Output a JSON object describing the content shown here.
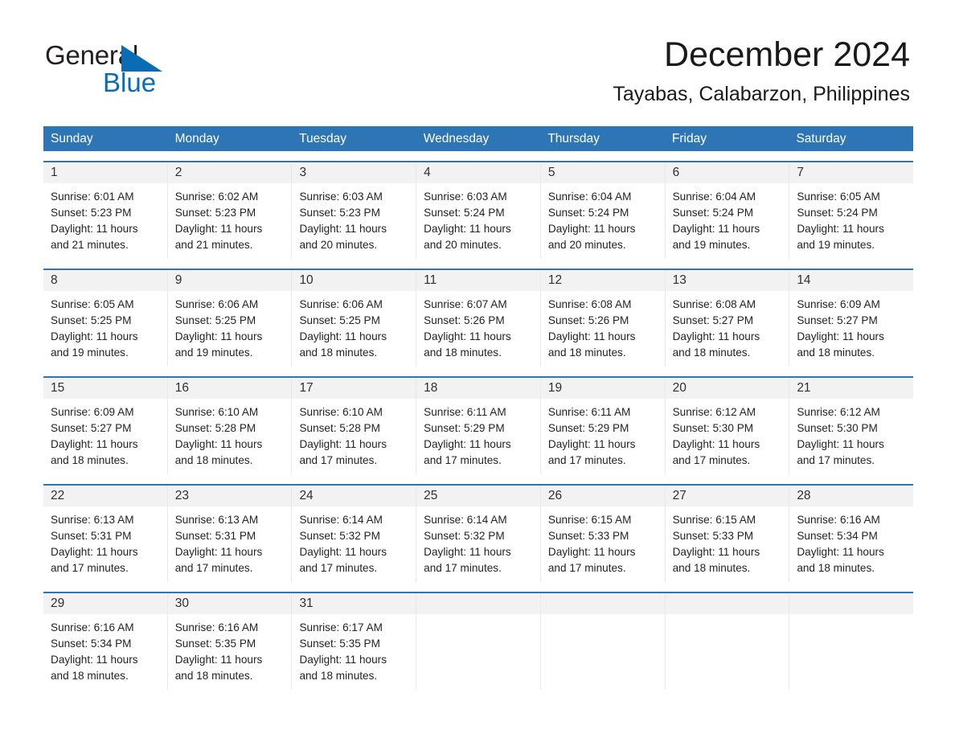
{
  "brand": {
    "name_part1": "General",
    "name_part2": "Blue",
    "triangle_color": "#0a6cb5"
  },
  "header": {
    "title": "December 2024",
    "subtitle": "Tayabas, Calabarzon, Philippines"
  },
  "theme": {
    "header_blue": "#2e75b6",
    "daynum_band": "#f2f2f2",
    "text": "#232323"
  },
  "calendar": {
    "weekday_headers": [
      "Sunday",
      "Monday",
      "Tuesday",
      "Wednesday",
      "Thursday",
      "Friday",
      "Saturday"
    ],
    "weeks": [
      [
        {
          "day": "1",
          "sunrise": "Sunrise: 6:01 AM",
          "sunset": "Sunset: 5:23 PM",
          "daylight_line1": "Daylight: 11 hours",
          "daylight_line2": "and 21 minutes."
        },
        {
          "day": "2",
          "sunrise": "Sunrise: 6:02 AM",
          "sunset": "Sunset: 5:23 PM",
          "daylight_line1": "Daylight: 11 hours",
          "daylight_line2": "and 21 minutes."
        },
        {
          "day": "3",
          "sunrise": "Sunrise: 6:03 AM",
          "sunset": "Sunset: 5:23 PM",
          "daylight_line1": "Daylight: 11 hours",
          "daylight_line2": "and 20 minutes."
        },
        {
          "day": "4",
          "sunrise": "Sunrise: 6:03 AM",
          "sunset": "Sunset: 5:24 PM",
          "daylight_line1": "Daylight: 11 hours",
          "daylight_line2": "and 20 minutes."
        },
        {
          "day": "5",
          "sunrise": "Sunrise: 6:04 AM",
          "sunset": "Sunset: 5:24 PM",
          "daylight_line1": "Daylight: 11 hours",
          "daylight_line2": "and 20 minutes."
        },
        {
          "day": "6",
          "sunrise": "Sunrise: 6:04 AM",
          "sunset": "Sunset: 5:24 PM",
          "daylight_line1": "Daylight: 11 hours",
          "daylight_line2": "and 19 minutes."
        },
        {
          "day": "7",
          "sunrise": "Sunrise: 6:05 AM",
          "sunset": "Sunset: 5:24 PM",
          "daylight_line1": "Daylight: 11 hours",
          "daylight_line2": "and 19 minutes."
        }
      ],
      [
        {
          "day": "8",
          "sunrise": "Sunrise: 6:05 AM",
          "sunset": "Sunset: 5:25 PM",
          "daylight_line1": "Daylight: 11 hours",
          "daylight_line2": "and 19 minutes."
        },
        {
          "day": "9",
          "sunrise": "Sunrise: 6:06 AM",
          "sunset": "Sunset: 5:25 PM",
          "daylight_line1": "Daylight: 11 hours",
          "daylight_line2": "and 19 minutes."
        },
        {
          "day": "10",
          "sunrise": "Sunrise: 6:06 AM",
          "sunset": "Sunset: 5:25 PM",
          "daylight_line1": "Daylight: 11 hours",
          "daylight_line2": "and 18 minutes."
        },
        {
          "day": "11",
          "sunrise": "Sunrise: 6:07 AM",
          "sunset": "Sunset: 5:26 PM",
          "daylight_line1": "Daylight: 11 hours",
          "daylight_line2": "and 18 minutes."
        },
        {
          "day": "12",
          "sunrise": "Sunrise: 6:08 AM",
          "sunset": "Sunset: 5:26 PM",
          "daylight_line1": "Daylight: 11 hours",
          "daylight_line2": "and 18 minutes."
        },
        {
          "day": "13",
          "sunrise": "Sunrise: 6:08 AM",
          "sunset": "Sunset: 5:27 PM",
          "daylight_line1": "Daylight: 11 hours",
          "daylight_line2": "and 18 minutes."
        },
        {
          "day": "14",
          "sunrise": "Sunrise: 6:09 AM",
          "sunset": "Sunset: 5:27 PM",
          "daylight_line1": "Daylight: 11 hours",
          "daylight_line2": "and 18 minutes."
        }
      ],
      [
        {
          "day": "15",
          "sunrise": "Sunrise: 6:09 AM",
          "sunset": "Sunset: 5:27 PM",
          "daylight_line1": "Daylight: 11 hours",
          "daylight_line2": "and 18 minutes."
        },
        {
          "day": "16",
          "sunrise": "Sunrise: 6:10 AM",
          "sunset": "Sunset: 5:28 PM",
          "daylight_line1": "Daylight: 11 hours",
          "daylight_line2": "and 18 minutes."
        },
        {
          "day": "17",
          "sunrise": "Sunrise: 6:10 AM",
          "sunset": "Sunset: 5:28 PM",
          "daylight_line1": "Daylight: 11 hours",
          "daylight_line2": "and 17 minutes."
        },
        {
          "day": "18",
          "sunrise": "Sunrise: 6:11 AM",
          "sunset": "Sunset: 5:29 PM",
          "daylight_line1": "Daylight: 11 hours",
          "daylight_line2": "and 17 minutes."
        },
        {
          "day": "19",
          "sunrise": "Sunrise: 6:11 AM",
          "sunset": "Sunset: 5:29 PM",
          "daylight_line1": "Daylight: 11 hours",
          "daylight_line2": "and 17 minutes."
        },
        {
          "day": "20",
          "sunrise": "Sunrise: 6:12 AM",
          "sunset": "Sunset: 5:30 PM",
          "daylight_line1": "Daylight: 11 hours",
          "daylight_line2": "and 17 minutes."
        },
        {
          "day": "21",
          "sunrise": "Sunrise: 6:12 AM",
          "sunset": "Sunset: 5:30 PM",
          "daylight_line1": "Daylight: 11 hours",
          "daylight_line2": "and 17 minutes."
        }
      ],
      [
        {
          "day": "22",
          "sunrise": "Sunrise: 6:13 AM",
          "sunset": "Sunset: 5:31 PM",
          "daylight_line1": "Daylight: 11 hours",
          "daylight_line2": "and 17 minutes."
        },
        {
          "day": "23",
          "sunrise": "Sunrise: 6:13 AM",
          "sunset": "Sunset: 5:31 PM",
          "daylight_line1": "Daylight: 11 hours",
          "daylight_line2": "and 17 minutes."
        },
        {
          "day": "24",
          "sunrise": "Sunrise: 6:14 AM",
          "sunset": "Sunset: 5:32 PM",
          "daylight_line1": "Daylight: 11 hours",
          "daylight_line2": "and 17 minutes."
        },
        {
          "day": "25",
          "sunrise": "Sunrise: 6:14 AM",
          "sunset": "Sunset: 5:32 PM",
          "daylight_line1": "Daylight: 11 hours",
          "daylight_line2": "and 17 minutes."
        },
        {
          "day": "26",
          "sunrise": "Sunrise: 6:15 AM",
          "sunset": "Sunset: 5:33 PM",
          "daylight_line1": "Daylight: 11 hours",
          "daylight_line2": "and 17 minutes."
        },
        {
          "day": "27",
          "sunrise": "Sunrise: 6:15 AM",
          "sunset": "Sunset: 5:33 PM",
          "daylight_line1": "Daylight: 11 hours",
          "daylight_line2": "and 18 minutes."
        },
        {
          "day": "28",
          "sunrise": "Sunrise: 6:16 AM",
          "sunset": "Sunset: 5:34 PM",
          "daylight_line1": "Daylight: 11 hours",
          "daylight_line2": "and 18 minutes."
        }
      ],
      [
        {
          "day": "29",
          "sunrise": "Sunrise: 6:16 AM",
          "sunset": "Sunset: 5:34 PM",
          "daylight_line1": "Daylight: 11 hours",
          "daylight_line2": "and 18 minutes."
        },
        {
          "day": "30",
          "sunrise": "Sunrise: 6:16 AM",
          "sunset": "Sunset: 5:35 PM",
          "daylight_line1": "Daylight: 11 hours",
          "daylight_line2": "and 18 minutes."
        },
        {
          "day": "31",
          "sunrise": "Sunrise: 6:17 AM",
          "sunset": "Sunset: 5:35 PM",
          "daylight_line1": "Daylight: 11 hours",
          "daylight_line2": "and 18 minutes."
        },
        {
          "day": "",
          "sunrise": "",
          "sunset": "",
          "daylight_line1": "",
          "daylight_line2": ""
        },
        {
          "day": "",
          "sunrise": "",
          "sunset": "",
          "daylight_line1": "",
          "daylight_line2": ""
        },
        {
          "day": "",
          "sunrise": "",
          "sunset": "",
          "daylight_line1": "",
          "daylight_line2": ""
        },
        {
          "day": "",
          "sunrise": "",
          "sunset": "",
          "daylight_line1": "",
          "daylight_line2": ""
        }
      ]
    ]
  }
}
